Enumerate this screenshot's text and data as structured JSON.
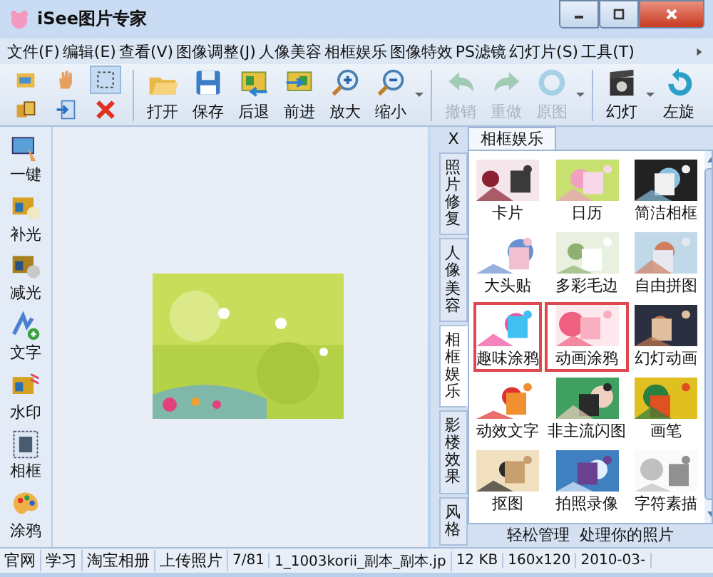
{
  "window": {
    "title": "iSee图片专家"
  },
  "menu": [
    {
      "label": "文件(F)"
    },
    {
      "label": "编辑(E)"
    },
    {
      "label": "查看(V)"
    },
    {
      "label": "图像调整(J)"
    },
    {
      "label": "人像美容"
    },
    {
      "label": "相框娱乐"
    },
    {
      "label": "图像特效"
    },
    {
      "label": "PS滤镜"
    },
    {
      "label": "幻灯片(S)"
    },
    {
      "label": "工具(T)"
    }
  ],
  "small_tools": [
    {
      "selected": false
    },
    {
      "selected": false
    },
    {
      "selected": true
    },
    {
      "selected": false
    },
    {
      "selected": false
    },
    {
      "selected": false
    }
  ],
  "toolbar": [
    {
      "kind": "button",
      "label": "打开",
      "disabled": false
    },
    {
      "kind": "button",
      "label": "保存",
      "disabled": false
    },
    {
      "kind": "button",
      "label": "后退",
      "disabled": false
    },
    {
      "kind": "button",
      "label": "前进",
      "disabled": false
    },
    {
      "kind": "button",
      "label": "放大",
      "disabled": false
    },
    {
      "kind": "button",
      "label": "缩小",
      "disabled": false
    },
    {
      "kind": "dropdown"
    },
    {
      "kind": "separator"
    },
    {
      "kind": "button",
      "label": "撤销",
      "disabled": true
    },
    {
      "kind": "button",
      "label": "重做",
      "disabled": true
    },
    {
      "kind": "button",
      "label": "原图",
      "disabled": true
    },
    {
      "kind": "dropdown"
    },
    {
      "kind": "separator"
    },
    {
      "kind": "button",
      "label": "幻灯",
      "disabled": false
    },
    {
      "kind": "dropdown"
    },
    {
      "kind": "button",
      "label": "左旋",
      "disabled": false
    }
  ],
  "sidebar": [
    {
      "label": "一键"
    },
    {
      "label": "补光"
    },
    {
      "label": "减光"
    },
    {
      "label": "文字"
    },
    {
      "label": "水印"
    },
    {
      "label": "相框"
    },
    {
      "label": "涂鸦"
    }
  ],
  "panel": {
    "close": "X",
    "tab": "相框娱乐",
    "vertical_tabs": [
      {
        "label": "照片修复",
        "selected": false
      },
      {
        "label": "人像美容",
        "selected": false
      },
      {
        "label": "相框娱乐",
        "selected": true
      },
      {
        "label": "影楼效果",
        "selected": false
      },
      {
        "label": "风格",
        "selected": false
      }
    ],
    "items": [
      {
        "label": "卡片",
        "highlighted": false
      },
      {
        "label": "日历",
        "highlighted": false
      },
      {
        "label": "简洁相框",
        "highlighted": false
      },
      {
        "label": "大头贴",
        "highlighted": false
      },
      {
        "label": "多彩毛边",
        "highlighted": false
      },
      {
        "label": "自由拼图",
        "highlighted": false
      },
      {
        "label": "趣味涂鸦",
        "highlighted": true
      },
      {
        "label": "动画涂鸦",
        "highlighted": true
      },
      {
        "label": "幻灯动画",
        "highlighted": false
      },
      {
        "label": "动效文字",
        "highlighted": false
      },
      {
        "label": "非主流闪图",
        "highlighted": false
      },
      {
        "label": "画笔",
        "highlighted": false
      },
      {
        "label": "抠图",
        "highlighted": false
      },
      {
        "label": "拍照录像",
        "highlighted": false
      },
      {
        "label": "字符素描",
        "highlighted": false
      }
    ],
    "footer": "轻松管理  处理你的照片"
  },
  "status_bar": [
    {
      "text": "官网"
    },
    {
      "text": "学习"
    },
    {
      "text": "淘宝相册"
    },
    {
      "text": "上传照片"
    },
    {
      "text": "7/81"
    },
    {
      "text": "1_1003korii_副本_副本.jp"
    },
    {
      "text": "12 KB"
    },
    {
      "text": "160x120"
    },
    {
      "text": "2010-03-"
    }
  ]
}
